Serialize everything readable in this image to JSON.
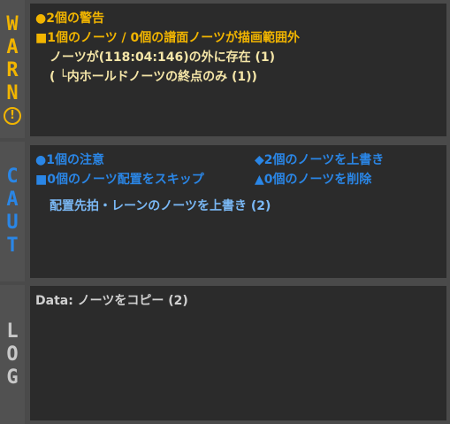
{
  "side": {
    "warn_letters": [
      "W",
      "A",
      "R",
      "N"
    ],
    "warn_icon": "!",
    "caut_letters": [
      "C",
      "A",
      "U",
      "T"
    ],
    "log_letters": [
      "L",
      "O",
      "G"
    ]
  },
  "colors": {
    "warn": "#f2b500",
    "caut": "#2a86e6",
    "log": "#d0d0d0",
    "panel_bg": "#2b2b2b"
  },
  "warn": {
    "summary": "●2個の警告",
    "lines": [
      "■1個のノーツ / 0個の譜面ノーツが描画範囲外"
    ],
    "details": [
      "ノーツが(118:04:146)の外に存在 (1)",
      "( └内ホールドノーツの終点のみ (1))"
    ]
  },
  "caut": {
    "col1": [
      "●1個の注意",
      "■0個のノーツ配置をスキップ"
    ],
    "col2": [
      "◆2個のノーツを上書き",
      "▲0個のノーツを削除"
    ],
    "details": [
      "配置先拍・レーンのノーツを上書き (2)"
    ]
  },
  "log": {
    "lines": [
      "Data: ノーツをコピー (2)"
    ]
  }
}
